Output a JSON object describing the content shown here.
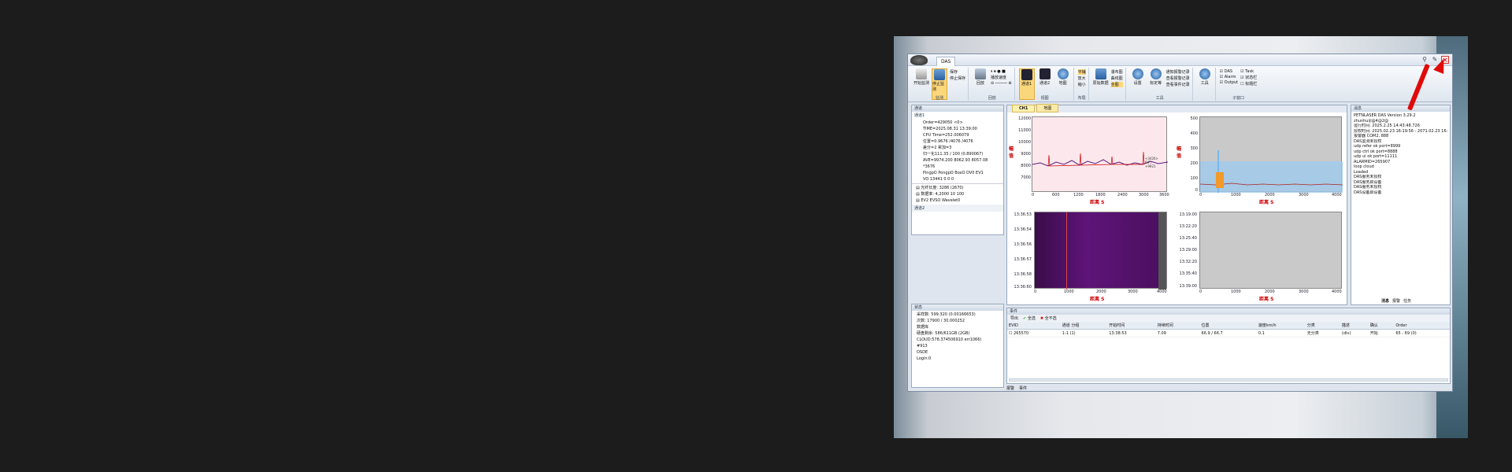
{
  "titlebar": {
    "tab_label": "DAS"
  },
  "ribbon": {
    "groups": [
      {
        "label": "监测",
        "buttons": [
          "开始监测",
          "停止监测"
        ],
        "small": [
          "保存",
          "停止保存"
        ]
      },
      {
        "label": "回放",
        "buttons": [
          "回放"
        ],
        "small": [
          "播放速度"
        ]
      },
      {
        "label": "视图",
        "buttons": [
          "通道1",
          "通道2",
          "地图"
        ]
      },
      {
        "label": "布局",
        "small": [
          "平铺",
          "放大",
          "缩小"
        ]
      },
      {
        "label": "",
        "buttons": [
          "原始数据"
        ],
        "small": [
          "瀑布图",
          "曲线图",
          "全图"
        ]
      },
      {
        "label": "工具",
        "buttons": [
          "设置",
          "标定等"
        ],
        "small": [
          "通知报警记录",
          "查看报警记录",
          "查看事件记录"
        ]
      },
      {
        "label": "",
        "buttons": [
          "工具"
        ]
      },
      {
        "label": "子窗口",
        "checks": [
          "DAS",
          "Alarm",
          "Output",
          "Task",
          "状态栏",
          "标题栏"
        ]
      }
    ]
  },
  "left": {
    "panel_title": "通道",
    "section1_title": "通道1",
    "section1_lines": [
      "Order=429050  <0>",
      "TIME=2025.08.31 13:39:00",
      "CPU Time=252.006079",
      "位置=0.9676 /4076 /4076",
      "差分=2 累加=3",
      "归一化111.35 / 100 (0.890067)",
      "AVE=9974.200 8062.93 8057.08",
      "*3676",
      "PingpO PongpO BoxO DV0 EV1",
      "VO 13441 0 0 0"
    ],
    "section1_items": [
      "光纤长度: 3286 (2670)",
      "数据率: 4,2000 10 100",
      "EV2 EVSO Wavelet0"
    ],
    "section2_title": "通道2",
    "status_title": "状态",
    "status_lines": [
      "采样数: 599.320 (0.00166653)",
      "次数: 17900 / 30.000252",
      "数据库",
      "硬盘剩余: 586/611GB (2GB)",
      "CLOUD:578.374506910 err1066)",
      "#913",
      "OSDE",
      "Login:0"
    ]
  },
  "center": {
    "tabs": [
      "CH1",
      "地图"
    ],
    "plot1": {
      "yticks": [
        "12000",
        "11000",
        "10000",
        "9000",
        "8000",
        "7000"
      ],
      "xticks": [
        "0",
        "600",
        "1200",
        "1800",
        "2400",
        "3000",
        "3600"
      ],
      "xname": "距离 S",
      "yname": "幅值"
    },
    "plot2": {
      "yticks": [
        "500",
        "400",
        "300",
        "200",
        "100",
        "0"
      ],
      "xticks": [
        "0",
        "1000",
        "2000",
        "3000",
        "4000"
      ],
      "xname": "距离 S",
      "yname": "幅值"
    },
    "plot3": {
      "yticks": [
        "13:36:53",
        "13:36:54",
        "13:36:56",
        "13:36:57",
        "13:36:58",
        "13:36:60"
      ],
      "xticks": [
        "0",
        "1000",
        "2000",
        "3000",
        "4000"
      ],
      "xname": "距离 S"
    },
    "plot4": {
      "yticks": [
        "13:19:00",
        "13:22:20",
        "13:25:40",
        "13:29:00",
        "13:32:20",
        "13:35:40",
        "13:39:00"
      ],
      "xticks": [
        "0",
        "1000",
        "2000",
        "3000",
        "4000"
      ],
      "xname": "距离 S"
    },
    "plot1_annotation": "<3426>\n6(F)\n+9921"
  },
  "log": {
    "title": "消息",
    "lines": [
      "PETNLASER DAS Version 3.29.2",
      "zhunhuiji@4@2@",
      "运行时间: 2025.2.25 14:43:48.726",
      "授权时间: 2025.02.23 16:19:56 - 2071.02.23 16:0",
      "报警器 COM2, 888",
      "DAS监测未授权",
      "udp refer ok port=8999",
      "udp ctrl ok port=8888",
      "udp ui ok port=11111",
      "ALARMID=265907",
      "loop cloud",
      "Loaded",
      "DAS服务未授权",
      "DAS服务启设备",
      "DAS服务未授权",
      "DAS设备启设备"
    ],
    "tabs": [
      "消息",
      "报警",
      "任务"
    ]
  },
  "events": {
    "title": "事件",
    "toolbar": [
      "导出",
      "全选",
      "全不选"
    ],
    "columns": [
      "EVID",
      "通道 分组",
      "开始时间",
      "持续时间",
      "位置",
      "速度km/h",
      "分类",
      "描述",
      "确认",
      "Order"
    ],
    "rows": [
      [
        "265570",
        "1-1 (1)",
        "13:38:53",
        "7.09",
        "66.9 / 66.7",
        "0.1",
        "无分类",
        "(dlv)",
        "开始",
        "65 - 69 (0)"
      ]
    ],
    "bottom_tabs": [
      "报警",
      "事件"
    ]
  }
}
